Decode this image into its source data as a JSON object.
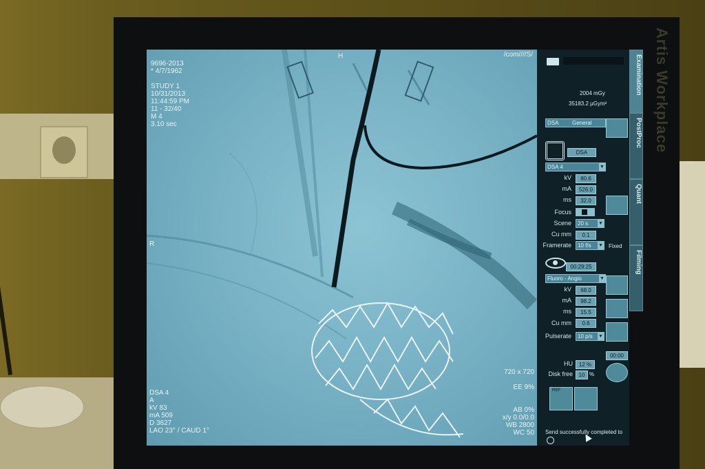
{
  "monitor": {
    "brand": "Artis Workplace"
  },
  "overlay": {
    "top_left": [
      "9696-2013",
      "* 4/7/1962",
      "",
      "STUDY 1",
      "10/31/2013",
      "11:44:59 PM",
      "11 - 32/40",
      "M 4",
      "3.10 sec"
    ],
    "top_center": "H",
    "top_right": "/com////S/",
    "left_marker": "R",
    "bottom_left": [
      "DSA 4",
      "A",
      "kV 83",
      "mA 509",
      "D 3627",
      "LAO 23° / CAUD 1°"
    ],
    "bottom_right": [
      "720 x 720",
      "",
      "EE 9%",
      "",
      "",
      "AB 0%",
      "x/y 0.0/0.0",
      "WB 2800",
      "WC 50"
    ]
  },
  "panel": {
    "dose_mgy": "2004 mGy",
    "dose_ugym2": "35183.2 µGym²",
    "acq_mode": "DSA",
    "acq_organ": "General",
    "acq_button": "DSA",
    "acq_protocol": "DSA 4",
    "acq_params": [
      {
        "label": "kV",
        "value": "80.6"
      },
      {
        "label": "mA",
        "value": "526.0"
      },
      {
        "label": "ms",
        "value": "32.0"
      }
    ],
    "focus_label": "Focus",
    "scene_label": "Scene",
    "scene_value": "20 s",
    "cumm_label": "Cu mm",
    "cumm_value": "0.1",
    "framerate_label": "Framerate",
    "framerate_value": "10 f/s",
    "fixed_label": "Fixed",
    "fluoro_time": "00:29:25",
    "fluoro_mode": "Fluoro - Angio",
    "fluoro_params": [
      {
        "label": "kV",
        "value": "68.0"
      },
      {
        "label": "mA",
        "value": "98.2"
      },
      {
        "label": "ms",
        "value": "15.5"
      }
    ],
    "fluoro_cumm_label": "Cu mm",
    "fluoro_cumm_value": "0.6",
    "pulserate_label": "Pulserate",
    "pulserate_value": "10 p/s",
    "timer": "00:00",
    "hu_label": "HU",
    "hu_value": "12 %",
    "disk_label": "Disk free",
    "disk_value": "10",
    "disk_unit": "%",
    "ref_label": "REF",
    "status": "Send successfully completed to"
  },
  "tabs": [
    "Examination",
    "PostProc",
    "Quant",
    "Filming"
  ],
  "colors": {
    "screen": "#7ab3c6",
    "panel": "#0f2026",
    "tab": "#365f6c"
  }
}
